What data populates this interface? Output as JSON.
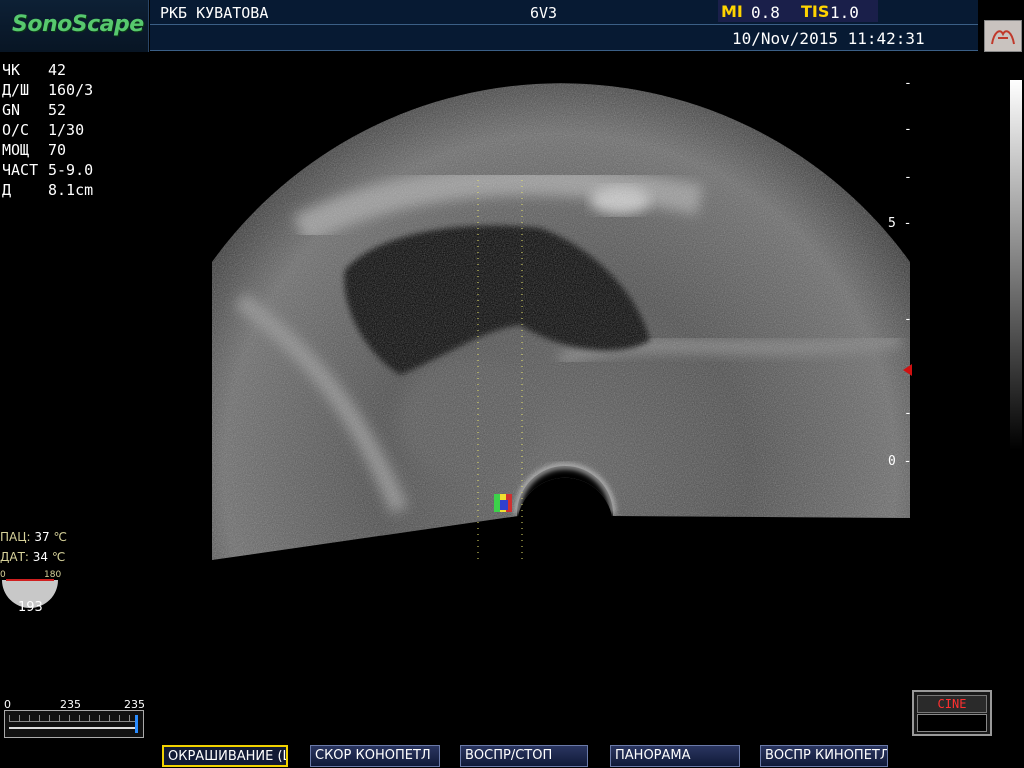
{
  "brand": {
    "logo": "SonoScape"
  },
  "header": {
    "hospital": "РКБ КУВАТОВА",
    "probe": "6V3",
    "mi_label": "MI",
    "mi_value": "0.8",
    "tis_label": "TIS",
    "tis_value": "1.0",
    "datetime": "10/Nov/2015 11:42:31"
  },
  "params": [
    {
      "key": "ЧК",
      "value": "42"
    },
    {
      "key": "Д/Ш",
      "value": "160/3"
    },
    {
      "key": "GN",
      "value": "52"
    },
    {
      "key": "О/С",
      "value": "1/30"
    },
    {
      "key": "МОЩ",
      "value": "70"
    },
    {
      "key": "ЧАСТ",
      "value": "5-9.0"
    },
    {
      "key": "Д",
      "value": "8.1cm"
    }
  ],
  "depth_scale": {
    "labels": [
      "5",
      "0"
    ]
  },
  "temps": {
    "patient_label": "ПАЦ:",
    "patient_value": "37",
    "patient_unit": "℃",
    "probe_label": "ДАТ:",
    "probe_value": "34",
    "probe_unit": "℃"
  },
  "angle": {
    "min": "0",
    "max": "180",
    "value": "193"
  },
  "slider": {
    "min": "0",
    "mid": "235",
    "max": "235",
    "level": 1.0
  },
  "buttons": [
    {
      "label": "ОКРАШИВАНИЕ (ЦВЕТ)",
      "selected": true
    },
    {
      "label": "СКОР КОНОПЕТЛ",
      "selected": false
    },
    {
      "label": "ВОСПР/СТОП",
      "selected": false
    },
    {
      "label": "ПАНОРАМА",
      "selected": false
    },
    {
      "label": "ВОСПР КИНОПЕТЛ",
      "selected": false
    }
  ],
  "cine": {
    "label": "CINE"
  },
  "colors": {
    "logo": "#57c86e",
    "mi": "#ffd400",
    "header_bg": "#071a33",
    "button_selected_border": "#f1d200"
  }
}
